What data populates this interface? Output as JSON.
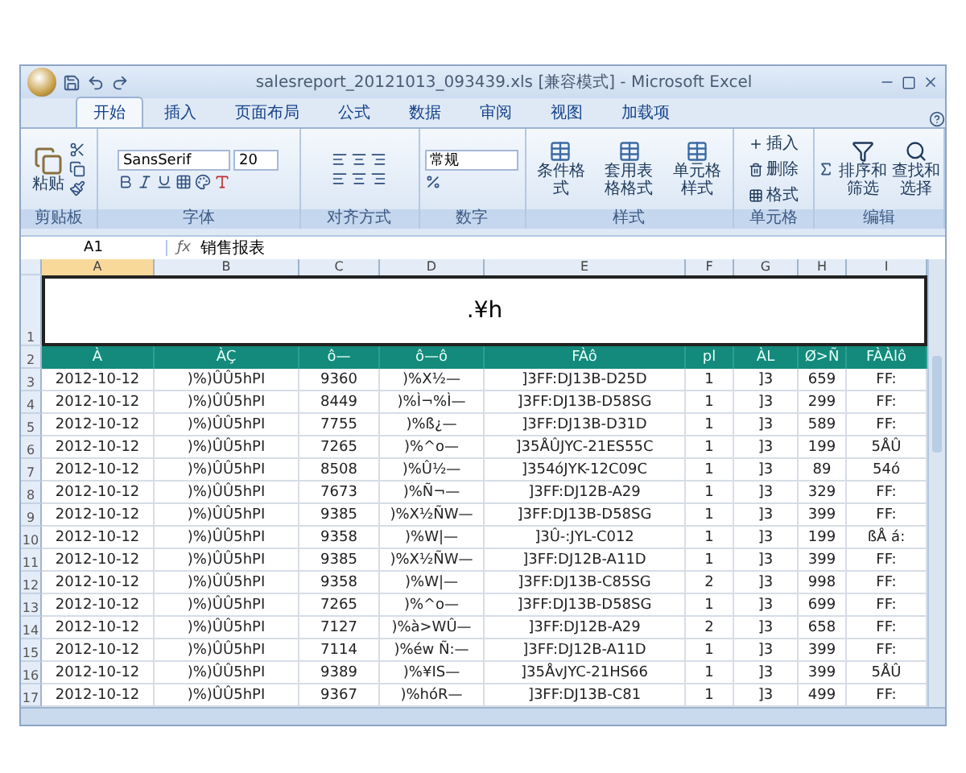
{
  "window": {
    "title": "salesreport_20121013_093439.xls  [兼容模式] - Microsoft Excel"
  },
  "ribbon_tabs": [
    {
      "label": "开始",
      "selected": true
    },
    {
      "label": "插入",
      "selected": false
    },
    {
      "label": "页面布局",
      "selected": false
    },
    {
      "label": "公式",
      "selected": false
    },
    {
      "label": "数据",
      "selected": false
    },
    {
      "label": "审阅",
      "selected": false
    },
    {
      "label": "视图",
      "selected": false
    },
    {
      "label": "加载项",
      "selected": false
    }
  ],
  "ribbon": {
    "clipboard": {
      "label": "剪贴板",
      "paste": "粘贴"
    },
    "font": {
      "label": "字体",
      "font_name": "SansSerif",
      "font_size": "20"
    },
    "alignment": {
      "label": "对齐方式"
    },
    "number": {
      "label": "数字",
      "format": "常规"
    },
    "styles": {
      "label": "样式",
      "buttons": [
        "条件格式",
        "套用表格格式",
        "单元格样式"
      ]
    },
    "cells": {
      "label": "单元格",
      "buttons": [
        "插入",
        "删除",
        "格式"
      ]
    },
    "editing": {
      "label": "编辑",
      "buttons": [
        "排序和筛选",
        "查找和选择"
      ]
    }
  },
  "formula_bar": {
    "name_box": "A1",
    "fx": "ƒx",
    "content": "销售报表"
  },
  "columns": [
    "A",
    "B",
    "C",
    "D",
    "E",
    "F",
    "G",
    "H",
    "I"
  ],
  "title_row": {
    "number": "1",
    "text": ".¥h"
  },
  "header_row": {
    "number": "2",
    "cells": [
      "À",
      "ÀÇ",
      "ô—",
      "ô—ô",
      "FÀô",
      "pl",
      "ÀL",
      "Ø>Ñ",
      "FÀÀlô"
    ]
  },
  "rows": [
    {
      "number": "3",
      "cells": [
        "2012-10-12",
        ")%)ÛÛ5hPI",
        "9360",
        ")%X½—",
        "]3FF:DJ13B-D25D",
        "1",
        "]3",
        "659",
        "FF:"
      ]
    },
    {
      "number": "4",
      "cells": [
        "2012-10-12",
        ")%)ÛÛ5hPI",
        "8449",
        ")%Ì¬%Ì—",
        "]3FF:DJ13B-D58SG",
        "1",
        "]3",
        "299",
        "FF:"
      ]
    },
    {
      "number": "5",
      "cells": [
        "2012-10-12",
        ")%)ÛÛ5hPI",
        "7755",
        ")%ß¿—",
        "]3FF:DJ13B-D31D",
        "1",
        "]3",
        "589",
        "FF:"
      ]
    },
    {
      "number": "6",
      "cells": [
        "2012-10-12",
        ")%)ÛÛ5hPI",
        "7265",
        ")%^o—",
        "]35ÅÛJYC-21ES55C",
        "1",
        "]3",
        "199",
        "5ÅÛ"
      ]
    },
    {
      "number": "7",
      "cells": [
        "2012-10-12",
        ")%)ÛÛ5hPI",
        "8508",
        ")%Û½—",
        "]354óJYK-12C09C",
        "1",
        "]3",
        "89",
        "54ó"
      ]
    },
    {
      "number": "8",
      "cells": [
        "2012-10-12",
        ")%)ÛÛ5hPI",
        "7673",
        ")%Ñ¬—",
        "]3FF:DJ12B-A29",
        "1",
        "]3",
        "329",
        "FF:"
      ]
    },
    {
      "number": "9",
      "cells": [
        "2012-10-12",
        ")%)ÛÛ5hPI",
        "9385",
        ")%X½ÑW—",
        "]3FF:DJ13B-D58SG",
        "1",
        "]3",
        "399",
        "FF:"
      ]
    },
    {
      "number": "10",
      "cells": [
        "2012-10-12",
        ")%)ÛÛ5hPI",
        "9358",
        ")%W|—",
        "]3Û-:JYL-C012",
        "1",
        "]3",
        "199",
        "ßÅ á:"
      ]
    },
    {
      "number": "11",
      "cells": [
        "2012-10-12",
        ")%)ÛÛ5hPI",
        "9385",
        ")%X½ÑW—",
        "]3FF:DJ12B-A11D",
        "1",
        "]3",
        "399",
        "FF:"
      ]
    },
    {
      "number": "12",
      "cells": [
        "2012-10-12",
        ")%)ÛÛ5hPI",
        "9358",
        ")%W|—",
        "]3FF:DJ13B-C85SG",
        "2",
        "]3",
        "998",
        "FF:"
      ]
    },
    {
      "number": "13",
      "cells": [
        "2012-10-12",
        ")%)ÛÛ5hPI",
        "7265",
        ")%^o—",
        "]3FF:DJ13B-D58SG",
        "1",
        "]3",
        "699",
        "FF:"
      ]
    },
    {
      "number": "14",
      "cells": [
        "2012-10-12",
        ")%)ÛÛ5hPI",
        "7127",
        ")%à>WÛ—",
        "]3FF:DJ12B-A29",
        "2",
        "]3",
        "658",
        "FF:"
      ]
    },
    {
      "number": "15",
      "cells": [
        "2012-10-12",
        ")%)ÛÛ5hPI",
        "7114",
        ")%éw Ñ:—",
        "]3FF:DJ12B-A11D",
        "1",
        "]3",
        "399",
        "FF:"
      ]
    },
    {
      "number": "16",
      "cells": [
        "2012-10-12",
        ")%)ÛÛ5hPI",
        "9389",
        ")%¥IS—",
        "]35ÅvJYC-21HS66",
        "1",
        "]3",
        "399",
        "5ÅÛ"
      ]
    },
    {
      "number": "17",
      "cells": [
        "2012-10-12",
        ")%)ÛÛ5hPI",
        "9367",
        ")%hóR—",
        "]3FF:DJ13B-C81",
        "1",
        "]3",
        "499",
        "FF:"
      ]
    }
  ]
}
